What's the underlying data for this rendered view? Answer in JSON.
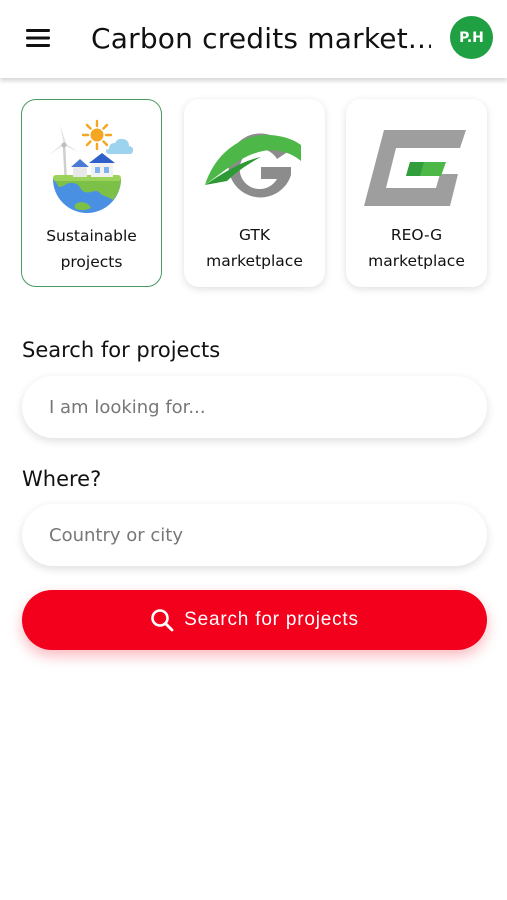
{
  "header": {
    "menu_icon": "hamburger-menu-icon",
    "title": "Carbon credits market...",
    "avatar_initials": "P.H",
    "avatar_color": "#1fa043"
  },
  "categories": [
    {
      "label_line1": "Sustainable",
      "label_line2": "projects",
      "icon": "sustainable-earth-icon",
      "selected": true
    },
    {
      "label_line1": "GTK",
      "label_line2": "marketplace",
      "icon": "gtk-logo-icon",
      "selected": false
    },
    {
      "label_line1": "REO-G",
      "label_line2": "marketplace",
      "icon": "reo-g-logo-icon",
      "selected": false
    }
  ],
  "search": {
    "label": "Search for projects",
    "placeholder": "I am looking for...",
    "value": ""
  },
  "where": {
    "label": "Where?",
    "placeholder": "Country or city",
    "value": ""
  },
  "submit": {
    "label": "Search for projects",
    "icon": "search-icon",
    "color": "#f2001c"
  },
  "colors": {
    "accent_red": "#f2001c",
    "selected_border": "#4a9a63",
    "brand_green": "#1fa043"
  }
}
